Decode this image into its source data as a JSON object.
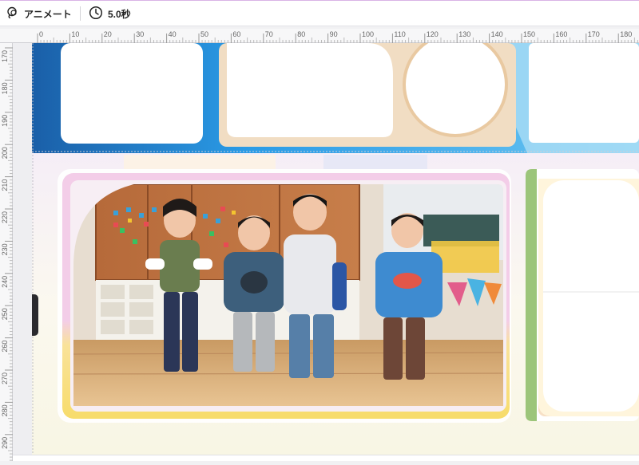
{
  "toolbar": {
    "animate_label": "アニメート",
    "duration_label": "5.0秒"
  },
  "ruler": {
    "horizontal_ticks": [
      "0",
      "10",
      "20",
      "30",
      "40",
      "50",
      "60",
      "70",
      "80",
      "90",
      "100",
      "110",
      "120",
      "130",
      "140",
      "150",
      "160",
      "170",
      "180"
    ],
    "vertical_ticks": [
      "170",
      "180",
      "190",
      "200",
      "210",
      "220",
      "230",
      "240",
      "250",
      "260",
      "270",
      "280",
      "290"
    ]
  },
  "icons": {
    "animate": "lasso-icon",
    "duration": "clock-icon"
  },
  "colors": {
    "accent_top_border": "#d9b3e6",
    "blue_banner": "#1f86d6",
    "frame_pink": "#eab7dc",
    "frame_yellow": "#f6dd6a"
  }
}
